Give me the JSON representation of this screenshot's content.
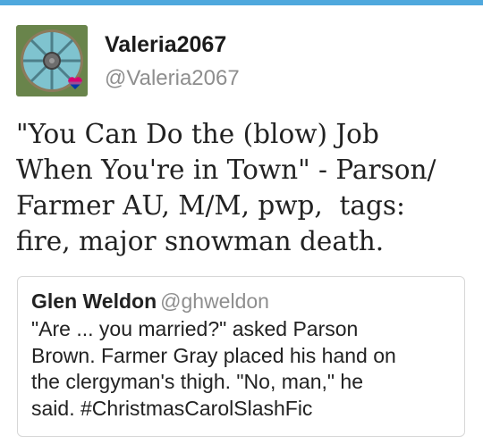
{
  "tweet": {
    "display_name": "Valeria2067",
    "handle": "@Valeria2067",
    "text": "\"You Can Do the (blow) Job\nWhen You're in Town\" - Parson/\nFarmer AU, M/M, pwp,  tags:\nfire, major snowman death."
  },
  "quoted_tweet": {
    "display_name": "Glen Weldon",
    "handle": "@ghweldon",
    "text": "\"Are ... you married?\" asked Parson\nBrown. Farmer Gray placed his hand on\nthe clergyman's thigh. \"No, man,\" he\nsaid. #ChristmasCarolSlashFic"
  },
  "colors": {
    "accent_bar": "#4fa8dd",
    "handle_gray": "#8e8e8e",
    "text_dark": "#222222",
    "card_border": "#d7d7d7"
  },
  "icons": {
    "avatar": "viking-shield-avatar",
    "badge": "bisexual-heart-icon"
  }
}
